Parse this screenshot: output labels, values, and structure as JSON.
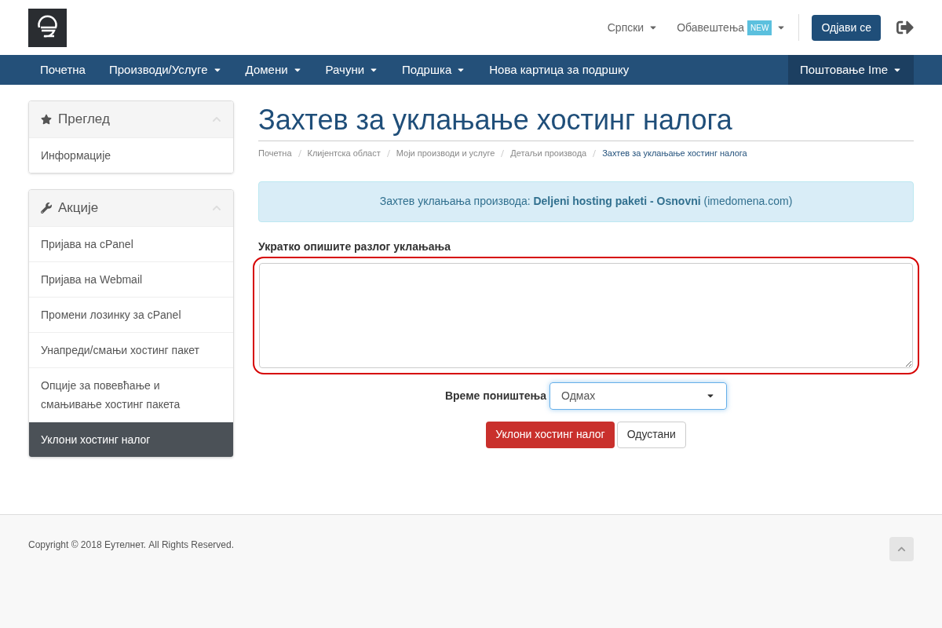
{
  "header": {
    "language": "Српски",
    "notifications": {
      "label": "Обавештења",
      "badge": "NEW"
    },
    "logout_button": "Одјави се"
  },
  "nav": {
    "items": [
      {
        "label": "Почетна",
        "has_menu": false
      },
      {
        "label": "Производи/Услуге",
        "has_menu": true
      },
      {
        "label": "Домени",
        "has_menu": true
      },
      {
        "label": "Рачуни",
        "has_menu": true
      },
      {
        "label": "Подршка",
        "has_menu": true
      },
      {
        "label": "Нова картица за подршку",
        "has_menu": false
      }
    ],
    "account": {
      "label": "Поштовање Ime",
      "has_menu": true
    }
  },
  "sidebar": {
    "panels": [
      {
        "kind": "overview",
        "title": "Преглед",
        "items": [
          {
            "label": "Информације",
            "selected": false
          }
        ]
      },
      {
        "kind": "actions",
        "title": "Акције",
        "items": [
          {
            "label": "Пријава на cPanel",
            "selected": false
          },
          {
            "label": "Пријава на Webmail",
            "selected": false
          },
          {
            "label": "Промени лозинку за cPanel",
            "selected": false
          },
          {
            "label": "Унапреди/смањи хостинг пакет",
            "selected": false
          },
          {
            "label": "Опције за повевћање и смањивање хостинг пакета",
            "selected": false
          },
          {
            "label": "Уклони хостинг налог",
            "selected": true
          }
        ]
      }
    ]
  },
  "page": {
    "title": "Захтев за уклањање хостинг налога",
    "breadcrumb": [
      {
        "label": "Почетна",
        "selected": false
      },
      {
        "label": "Клијентска област",
        "selected": false
      },
      {
        "label": "Моји производи и услуге",
        "selected": false
      },
      {
        "label": "Детаљи производа",
        "selected": false
      },
      {
        "label": "Захтев за уклањање хостинг налога",
        "selected": true
      }
    ],
    "info": "Захтев уклањања производа: **Deljeni hosting paketi - Osnovni** (imedomena.com)",
    "reason_label": "Укратко опишите разлог уклањања",
    "reason_highlighted": true,
    "timing_label": "Време поништења",
    "timing_value": "Одмах",
    "submit_button": "Уклони хостинг налог",
    "cancel_button": "Одустани"
  },
  "footer": {
    "copyright": "Copyright © 2018 Еутелнет. All Rights Reserved."
  }
}
